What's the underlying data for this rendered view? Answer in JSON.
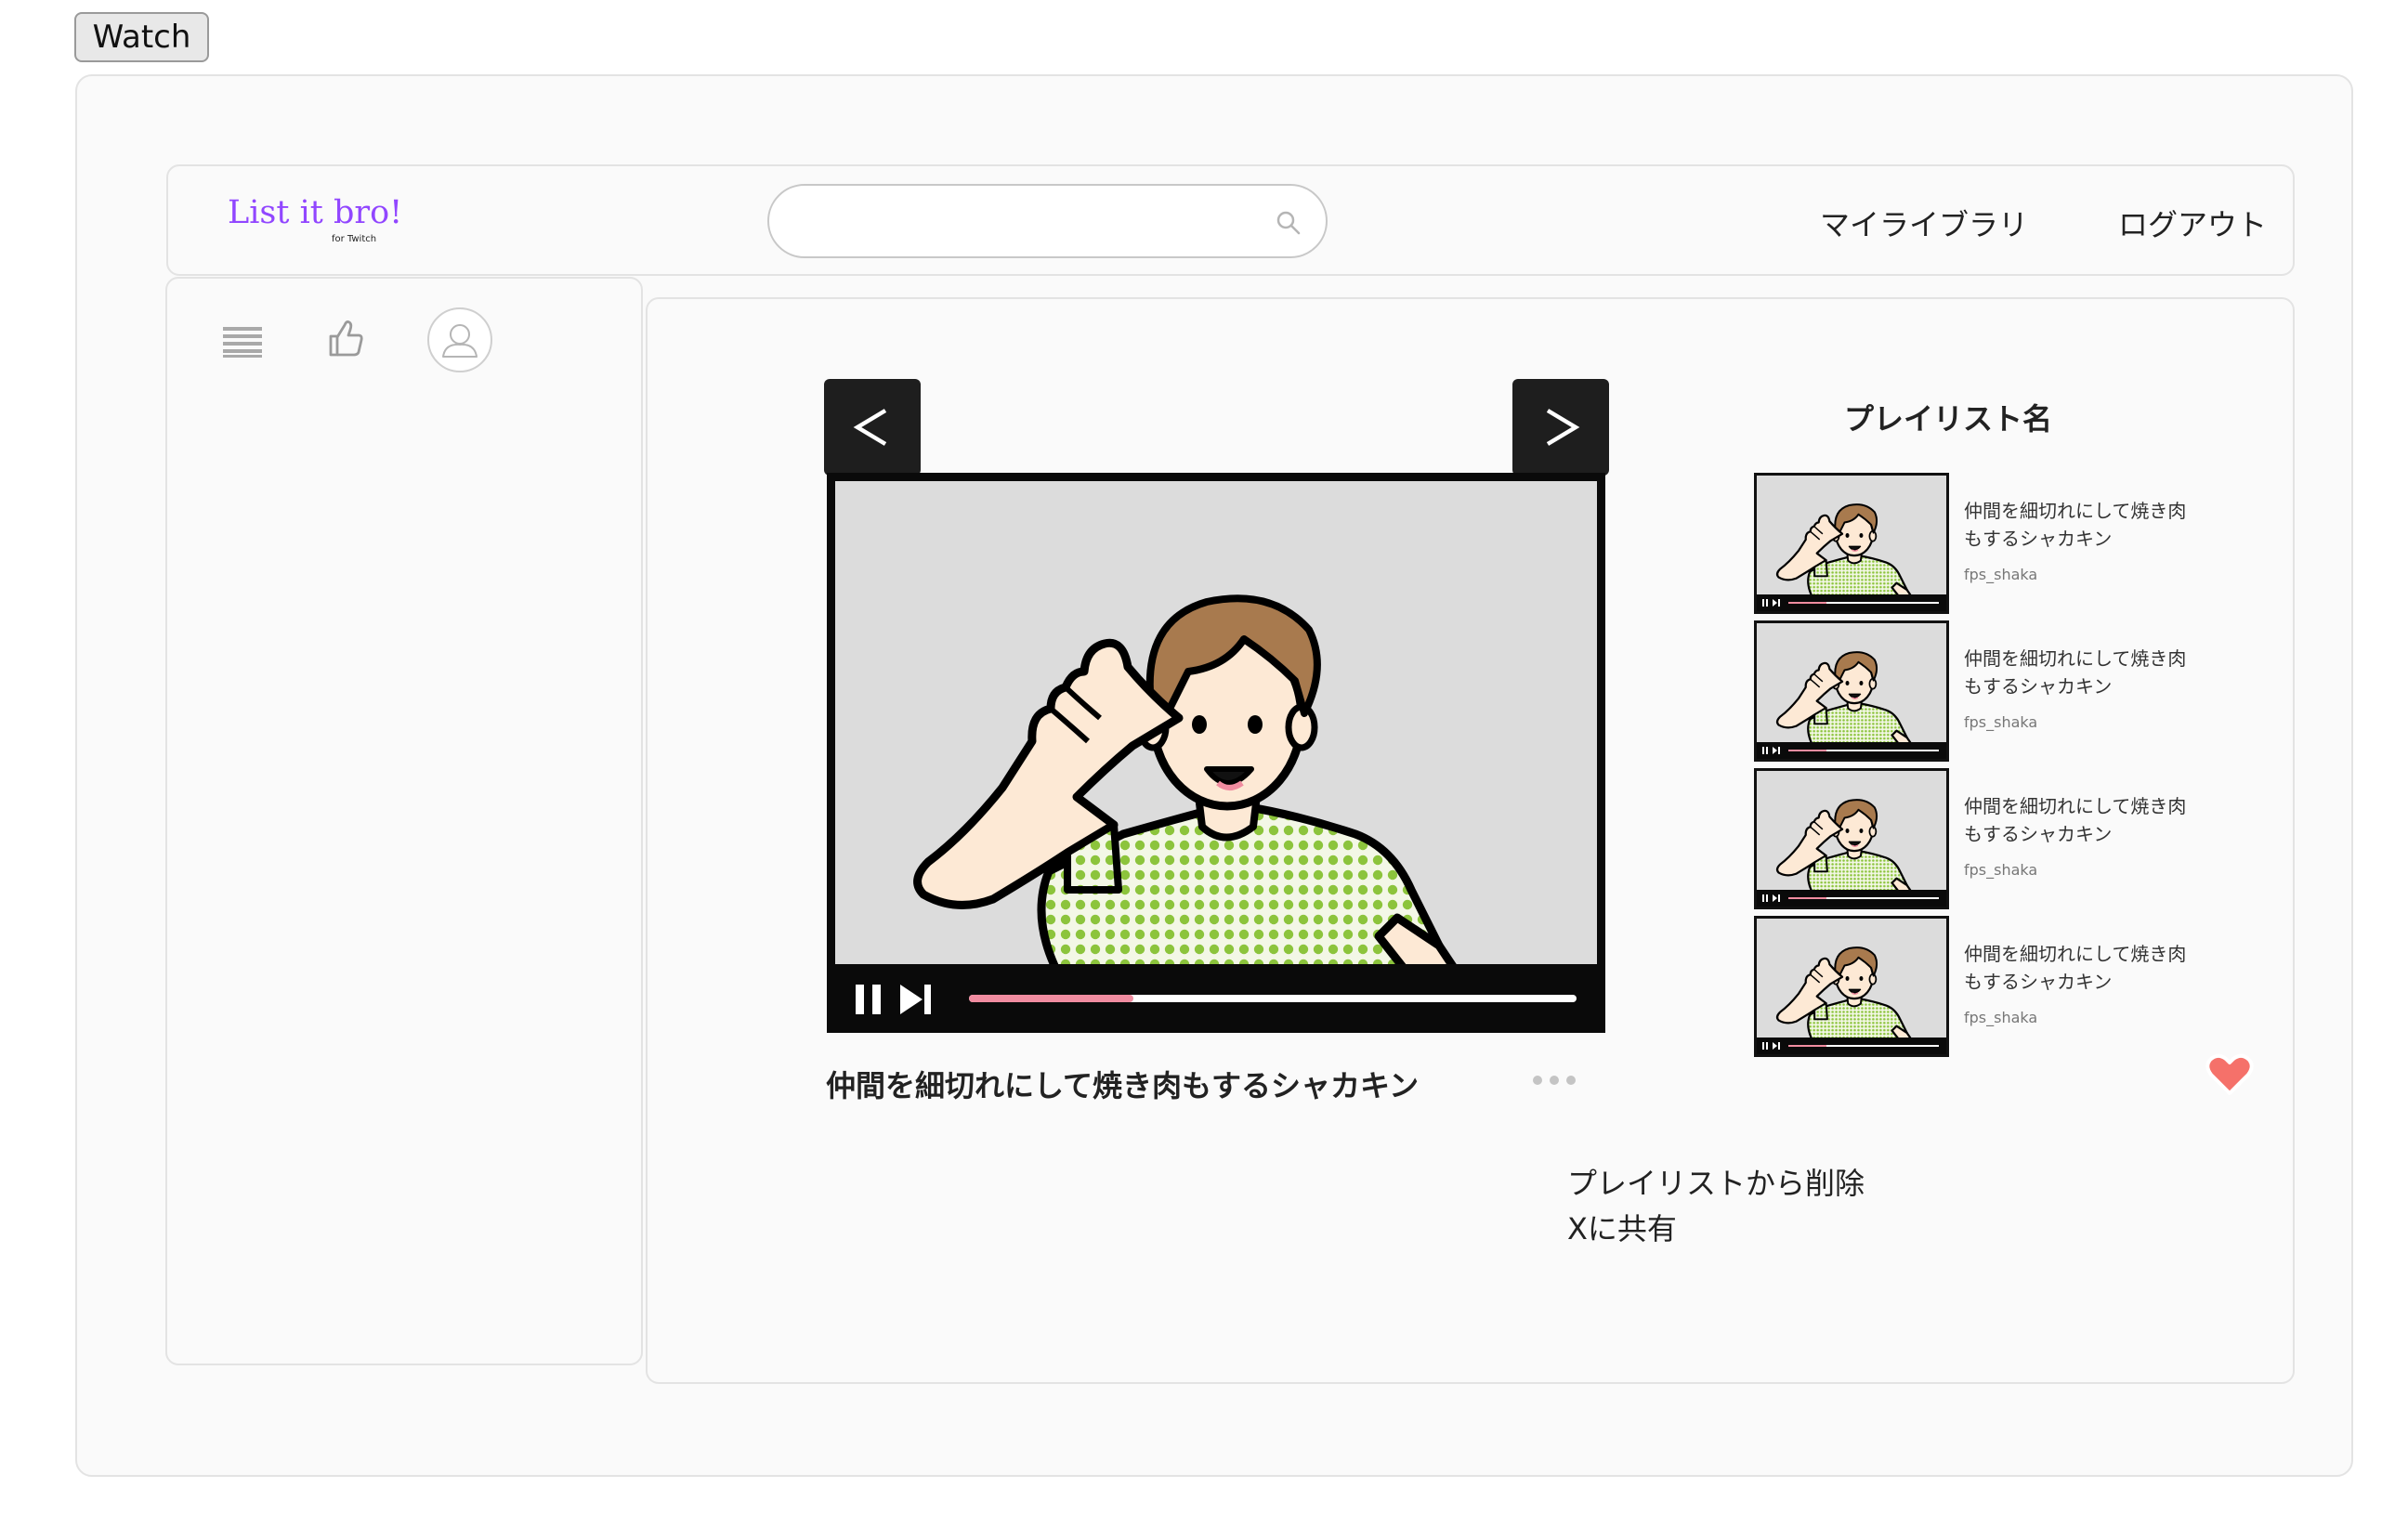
{
  "watch_button": {
    "label": "Watch"
  },
  "header": {
    "logo": {
      "main": "List it bro!",
      "sub": "for Twitch"
    },
    "search": {
      "value": "",
      "placeholder": ""
    },
    "nav": [
      {
        "label": "マイライブラリ"
      },
      {
        "label": "ログアウト"
      }
    ]
  },
  "sidebar": {
    "icons": [
      "list-icon",
      "thumbs-up-icon",
      "user-avatar-icon"
    ]
  },
  "player": {
    "title": "仲間を細切れにして焼き肉もするシャカキン",
    "progress": 0.27,
    "prev_label": "<",
    "next_label": ">"
  },
  "playlist": {
    "name": "プレイリスト名",
    "items": [
      {
        "title": "仲間を細切れにして焼き肉もするシャカキン",
        "channel": "fps_shaka",
        "progress": 0.25
      },
      {
        "title": "仲間を細切れにして焼き肉もするシャカキン",
        "channel": "fps_shaka",
        "progress": 0.25
      },
      {
        "title": "仲間を細切れにして焼き肉もするシャカキン",
        "channel": "fps_shaka",
        "progress": 0.25
      },
      {
        "title": "仲間を細切れにして焼き肉もするシャカキン",
        "channel": "fps_shaka",
        "progress": 0.25
      }
    ]
  },
  "context_menu": {
    "items": [
      {
        "label": "プレイリストから削除"
      },
      {
        "label": "Xに共有"
      }
    ]
  },
  "colors": {
    "brand": "#9146ff",
    "progress": "#f08ca0",
    "heart": "#f5716a",
    "shirt_dots": "#8cc43c",
    "hair": "#a87a4e",
    "skin": "#fde9d5"
  }
}
